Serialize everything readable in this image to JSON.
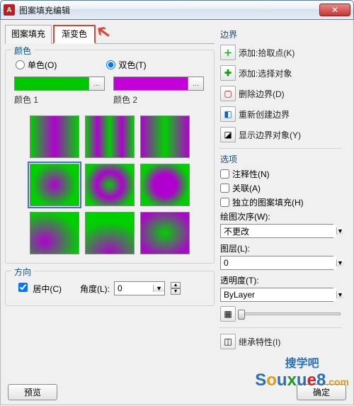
{
  "window": {
    "title": "图案填充编辑",
    "close_label": "✕"
  },
  "tabs": {
    "tab1": "图案填充",
    "tab2": "渐变色"
  },
  "color": {
    "group": "颜色",
    "single": "单色(O)",
    "double": "双色(T)",
    "color1_label": "颜色 1",
    "color2_label": "颜色 2",
    "c1": "#00c800",
    "c2": "#c400d8"
  },
  "direction": {
    "group": "方向",
    "centered": "居中(C)",
    "angle_label": "角度(L):",
    "angle_value": "0"
  },
  "boundary": {
    "section": "边界",
    "add_pick": "添加:拾取点(K)",
    "add_select": "添加:选择对象",
    "remove": "删除边界(D)",
    "recreate": "重新创建边界",
    "show": "显示边界对象(Y)"
  },
  "options": {
    "section": "选项",
    "annotative": "注释性(N)",
    "associative": "关联(A)",
    "independent": "独立的图案填充(H)",
    "draw_order_label": "绘图次序(W):",
    "draw_order_value": "不更改",
    "layer_label": "图层(L):",
    "layer_value": "0",
    "transparency_label": "透明度(T):",
    "transparency_value": "ByLayer",
    "inherit": "继承特性(I)"
  },
  "buttons": {
    "preview": "预览",
    "ok": "确定"
  },
  "watermark": {
    "line1": "搜学吧",
    "line2": "Souxue8",
    "suffix": ".com"
  }
}
